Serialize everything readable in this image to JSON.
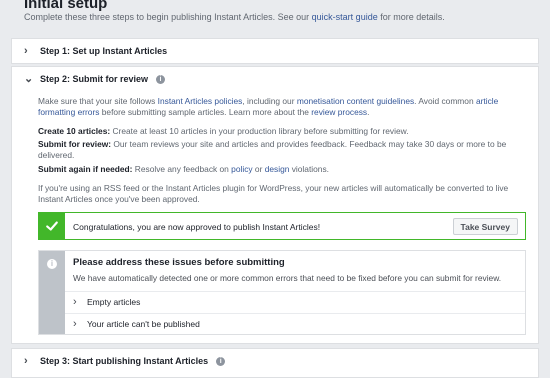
{
  "header": {
    "title": "Initial setup",
    "subtitle_pre": "Complete these three steps to begin publishing Instant Articles. See our ",
    "subtitle_link": "quick-start guide",
    "subtitle_post": " for more details."
  },
  "step1": {
    "label": "Step 1: Set up Instant Articles"
  },
  "step2": {
    "label": "Step 2: Submit for review",
    "intro": {
      "t1": "Make sure that your site follows ",
      "l1": "Instant Articles policies",
      "t2": ", including our ",
      "l2": "monetisation content guidelines",
      "t3": ". Avoid common ",
      "l3": "article formatting errors",
      "t4": " before submitting sample articles. Learn more about the ",
      "l4": "review process",
      "t5": "."
    },
    "create": {
      "label": "Create 10 articles:",
      "text": " Create at least 10 articles in your production library before submitting for review."
    },
    "submit": {
      "label": "Submit for review:",
      "text": " Our team reviews your site and articles and provides feedback. Feedback may take 30 days or more to be delivered."
    },
    "again": {
      "label": "Submit again if needed:",
      "text_pre": " Resolve any feedback on ",
      "link1": "policy",
      "text_mid": " or ",
      "link2": "design",
      "text_post": " violations."
    },
    "rss_note": "If you're using an RSS feed or the Instant Articles plugin for WordPress, your new articles will automatically be converted to live Instant Articles once you've been approved.",
    "success": {
      "message": "Congratulations, you are now approved to publish Instant Articles!",
      "button": "Take Survey"
    },
    "issues": {
      "title": "Please address these issues before submitting",
      "desc": "We have automatically detected one or more common errors that need to be fixed before you can submit for review.",
      "items": [
        "Empty articles",
        "Your article can't be published"
      ]
    }
  },
  "step3": {
    "label": "Step 3: Start publishing Instant Articles"
  },
  "colors": {
    "success": "#42b72a",
    "link": "#365899",
    "background": "#e9ebee"
  }
}
